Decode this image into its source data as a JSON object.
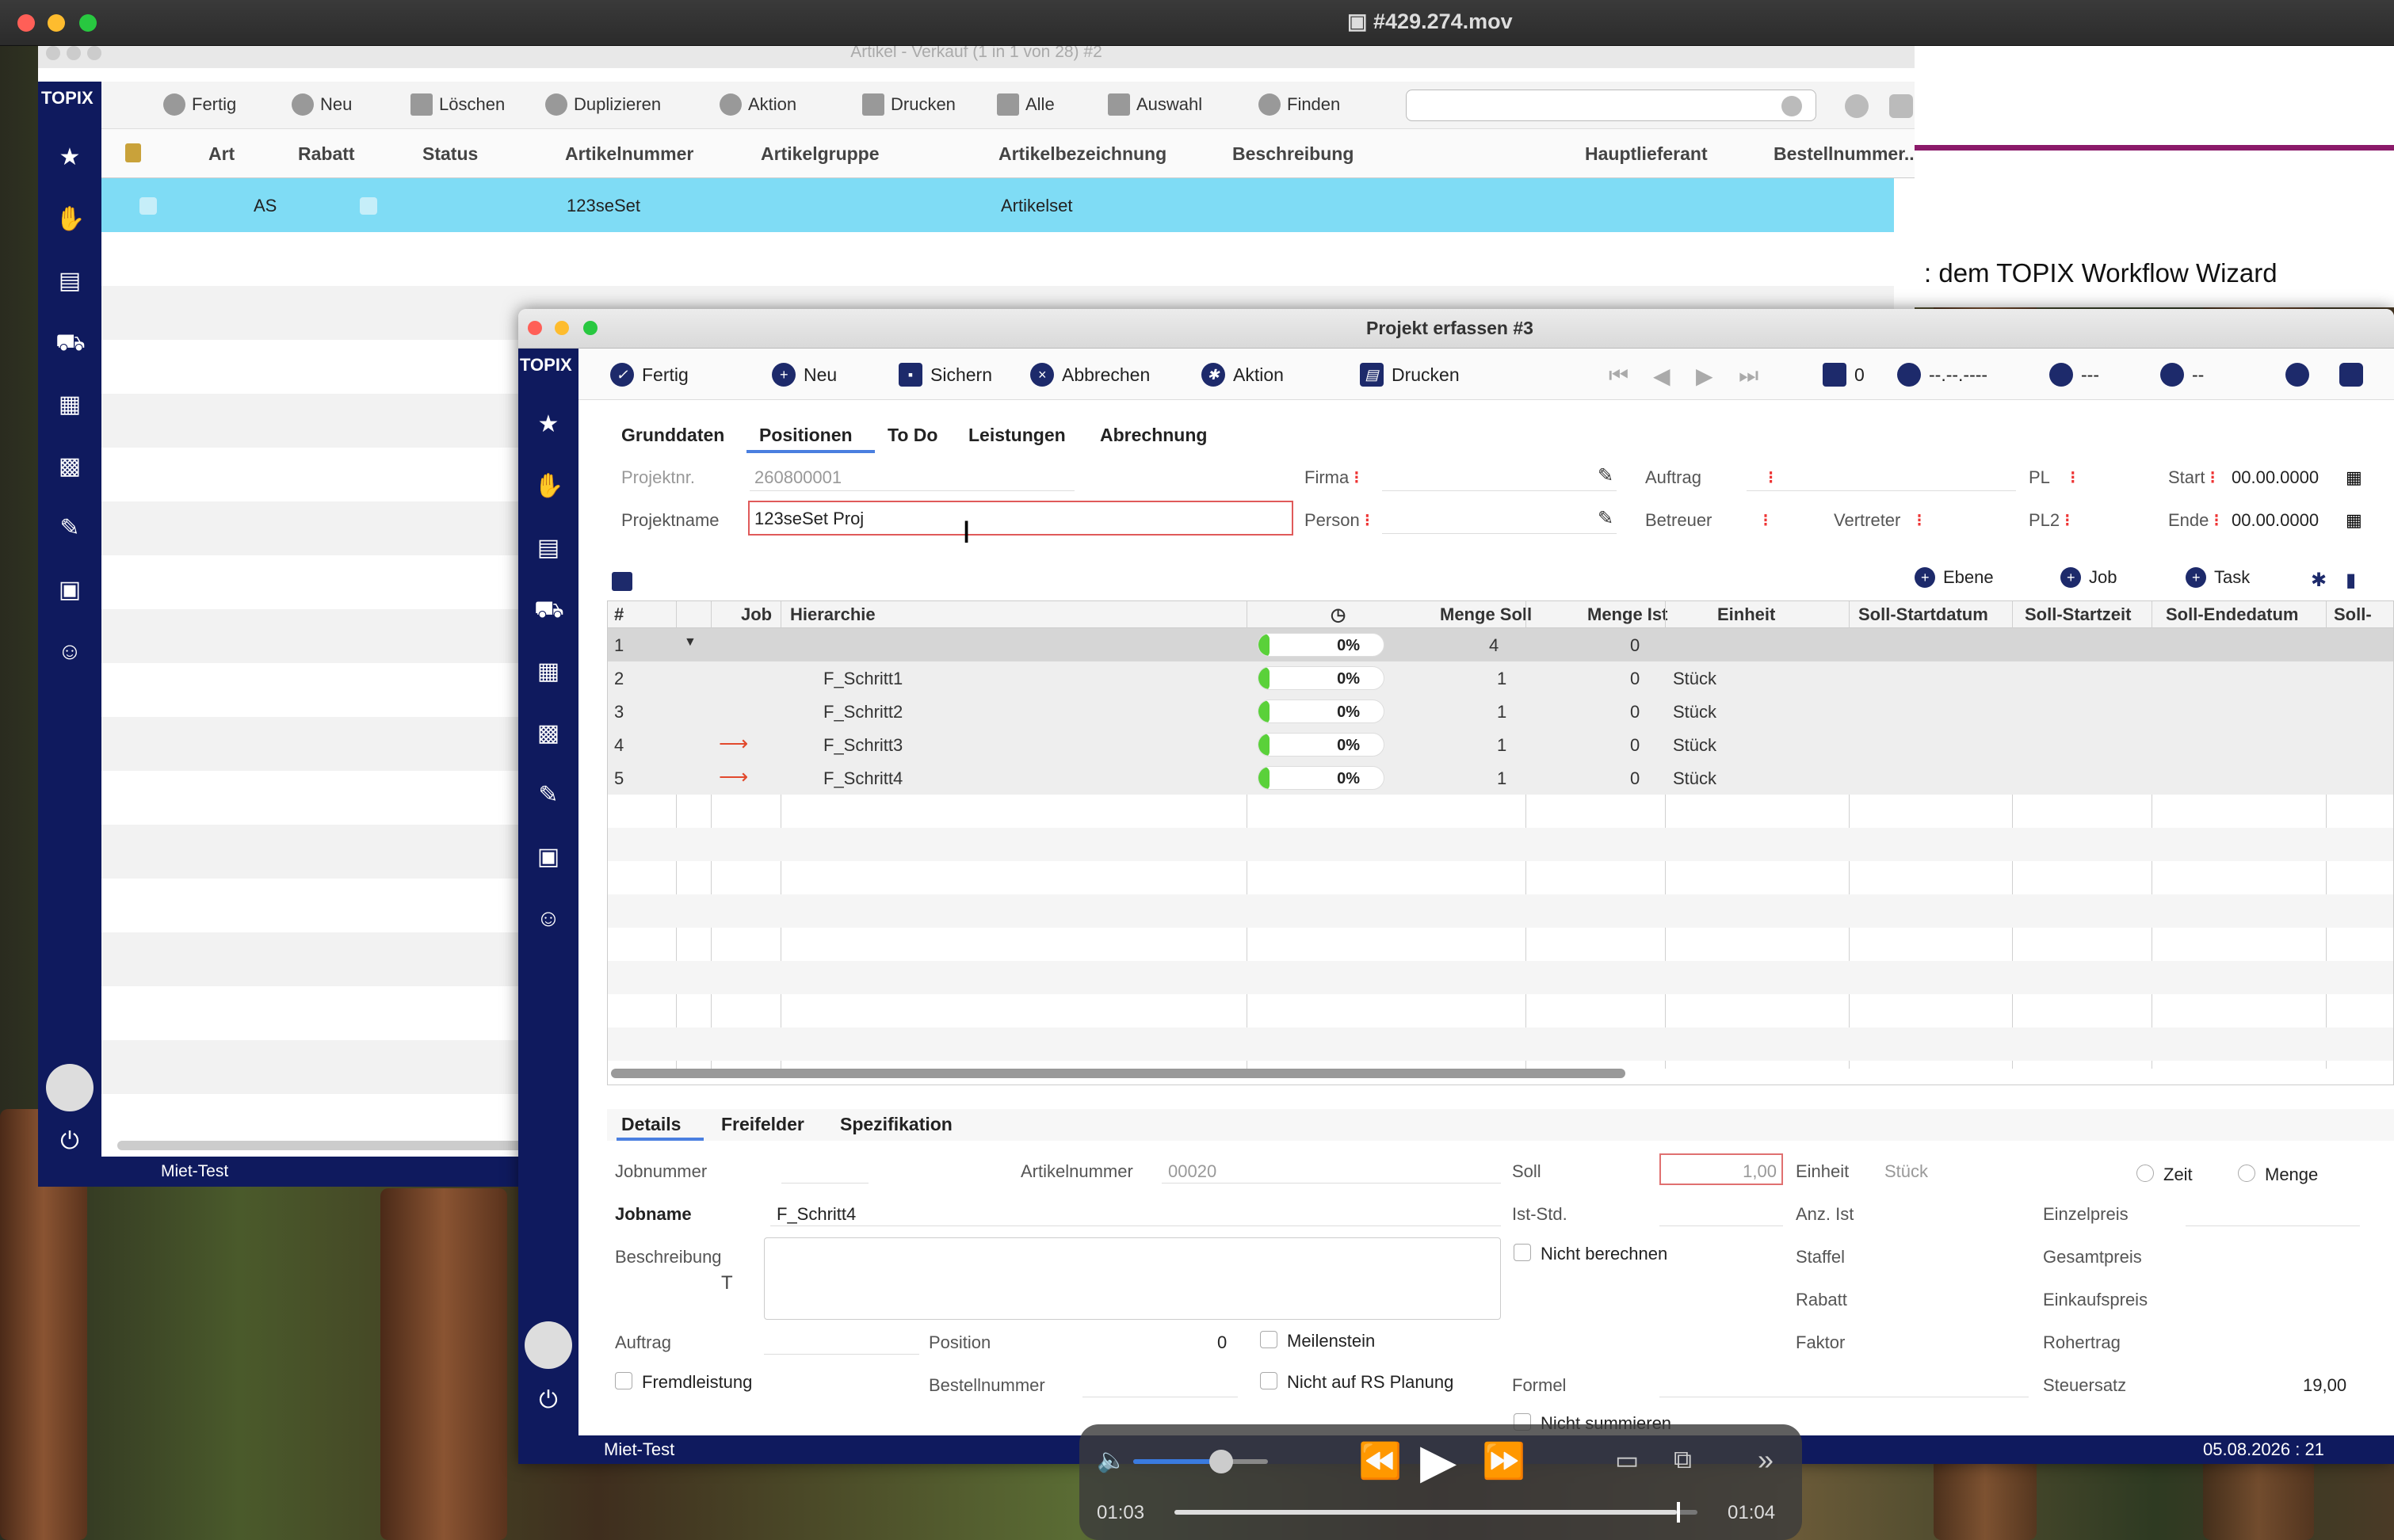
{
  "qt": {
    "title": "#429.274.mov"
  },
  "win1": {
    "title": "Artikel - Verkauf (1 in 1 von 28) #2",
    "brand": "TOPIX",
    "toolbar": [
      "Fertig",
      "Neu",
      "Löschen",
      "Duplizieren",
      "Aktion",
      "Drucken",
      "Alle",
      "Auswahl",
      "Finden"
    ],
    "columns": [
      "Art",
      "Rabatt",
      "Status",
      "Artikelnummer",
      "Artikelgruppe",
      "Artikelbezeichnung",
      "Beschreibung",
      "Hauptlieferant",
      "Bestellnummer..."
    ],
    "row": {
      "art": "AS",
      "artikelnummer": "123seSet",
      "bezeichnung": "Artikelset"
    },
    "status": "Miet-Test"
  },
  "bg_window": {
    "text": ": dem TOPIX Workflow Wizard"
  },
  "win2": {
    "title": "Projekt erfassen #3",
    "brand": "TOPIX",
    "toolbar": [
      "Fertig",
      "Neu",
      "Sichern",
      "Abbrechen",
      "Aktion",
      "Drucken"
    ],
    "toolbar_right": {
      "lock": "0",
      "date": "--.--.----",
      "person": "---",
      "attach": "--"
    },
    "tabs": [
      "Grunddaten",
      "Positionen",
      "To Do",
      "Leistungen",
      "Abrechnung"
    ],
    "active_tab": "Positionen",
    "form": {
      "projektnr_label": "Projektnr.",
      "projektnr": "260800001",
      "projektname_label": "Projektname",
      "projektname": "123seSet Proj",
      "firma": "Firma",
      "person": "Person",
      "auftrag": "Auftrag",
      "betreuer": "Betreuer",
      "vertreter": "Vertreter",
      "pl": "PL",
      "pl2": "PL2",
      "start_label": "Start",
      "start": "00.00.0000",
      "ende_label": "Ende",
      "ende": "00.00.0000"
    },
    "grid_actions": [
      "Ebene",
      "Job",
      "Task"
    ],
    "grid_columns": [
      "#",
      "Job",
      "Hierarchie",
      "Menge Soll",
      "Menge Ist",
      "Einheit",
      "Soll-Startdatum",
      "Soll-Startzeit",
      "Soll-Endedatum",
      "Soll-"
    ],
    "rows": [
      {
        "n": "1",
        "name": "",
        "pct": "0%",
        "soll": "4",
        "ist": "0",
        "einheit": ""
      },
      {
        "n": "2",
        "name": "F_Schritt1",
        "pct": "0%",
        "soll": "1",
        "ist": "0",
        "einheit": "Stück"
      },
      {
        "n": "3",
        "name": "F_Schritt2",
        "pct": "0%",
        "soll": "1",
        "ist": "0",
        "einheit": "Stück"
      },
      {
        "n": "4",
        "name": "F_Schritt3",
        "pct": "0%",
        "soll": "1",
        "ist": "0",
        "einheit": "Stück"
      },
      {
        "n": "5",
        "name": "F_Schritt4",
        "pct": "0%",
        "soll": "1",
        "ist": "0",
        "einheit": "Stück"
      }
    ],
    "detail_tabs": [
      "Details",
      "Freifelder",
      "Spezifikation"
    ],
    "details": {
      "jobnummer": "Jobnummer",
      "artikelnummer_label": "Artikelnummer",
      "artikelnummer": "00020",
      "soll_label": "Soll",
      "soll": "1,00",
      "einheit_label": "Einheit",
      "einheit": "Stück",
      "zeit": "Zeit",
      "menge": "Menge",
      "jobname_label": "Jobname",
      "jobname": "F_Schritt4",
      "ist_std": "Ist-Std.",
      "anz_ist": "Anz. Ist",
      "einzelpreis": "Einzelpreis",
      "beschreibung": "Beschreibung",
      "nicht_berechnen": "Nicht berechnen",
      "staffel": "Staffel",
      "gesamtpreis": "Gesamtpreis",
      "rabatt": "Rabatt",
      "einkaufspreis": "Einkaufspreis",
      "auftrag": "Auftrag",
      "position_label": "Position",
      "position": "0",
      "meilenstein": "Meilenstein",
      "faktor": "Faktor",
      "rohertrag": "Rohertrag",
      "fremdleistung": "Fremdleistung",
      "bestellnummer": "Bestellnummer",
      "nicht_rs": "Nicht auf RS Planung",
      "formel": "Formel",
      "steuersatz_label": "Steuersatz",
      "steuersatz": "19,00",
      "nicht_summieren": "Nicht summieren"
    },
    "status_left": "Miet-Test",
    "status_right": "05.08.2026 : 21"
  },
  "player": {
    "elapsed": "01:03",
    "remaining": "01:04",
    "volume": 0.65,
    "progress": 0.96
  }
}
